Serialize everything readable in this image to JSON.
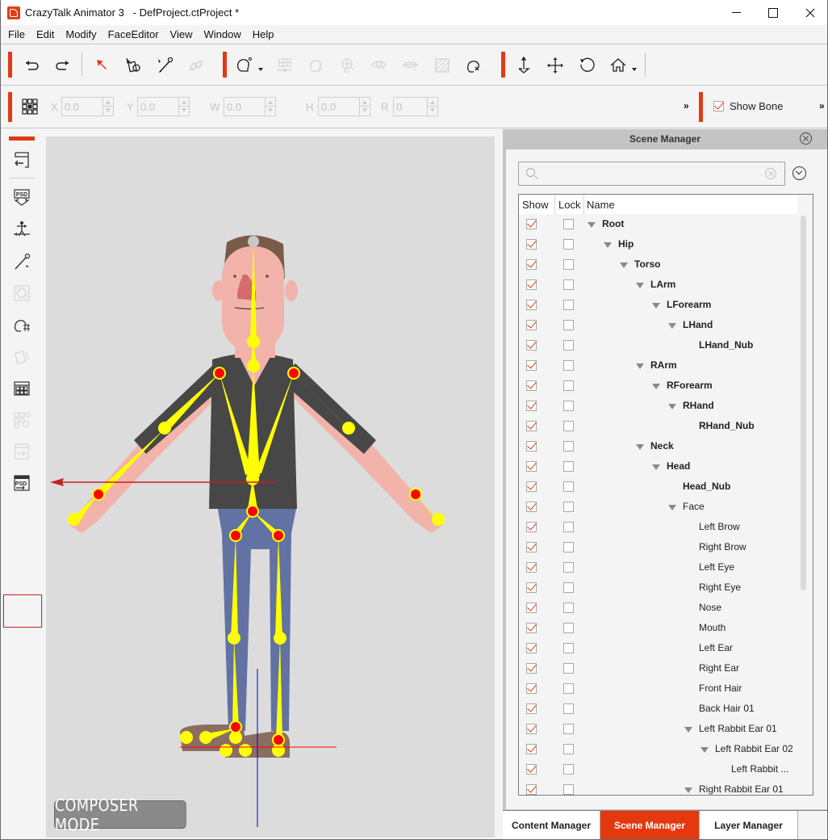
{
  "window": {
    "app_name": "CrazyTalk Animator 3",
    "title": "CrazyTalk Animator 3   - DefProject.ctProject *",
    "controls": [
      "minimize",
      "maximize",
      "close"
    ]
  },
  "menu": [
    "File",
    "Edit",
    "Modify",
    "FaceEditor",
    "View",
    "Window",
    "Help"
  ],
  "toolbar": {
    "groups": [
      {
        "icons": [
          "undo-icon",
          "redo-icon"
        ]
      },
      {
        "icons": [
          "select-icon",
          "transform-icon",
          "bone-edit-icon",
          "link-icon-disabled"
        ]
      },
      {
        "icons": [
          "face-setup-icon",
          "sprite-grid-icon-disabled",
          "head-turn-icon-disabled",
          "face-key-icon-disabled",
          "eye-icon-disabled",
          "mouth-icon-disabled",
          "mask-icon-disabled",
          "head-reset-icon"
        ]
      },
      {
        "icons": [
          "move-z-icon",
          "move-icon",
          "rotate-icon",
          "home-icon"
        ]
      }
    ]
  },
  "transform": {
    "anchor_icon": "anchor-grid-icon",
    "fields": [
      {
        "label": "X",
        "value": "0.0"
      },
      {
        "label": "Y",
        "value": "0.0"
      },
      {
        "label": "W",
        "value": "0.0"
      },
      {
        "label": "H",
        "value": "0.0"
      },
      {
        "label": "R",
        "value": "0"
      }
    ],
    "more_label": "»",
    "show_bone": {
      "label": "Show Bone",
      "checked": true
    }
  },
  "sidebar": {
    "items": [
      {
        "name": "back-to-stage-icon",
        "enabled": true
      },
      {
        "name": "psd-import-icon",
        "enabled": true
      },
      {
        "name": "bone-editor-icon",
        "enabled": true
      },
      {
        "name": "bone-brush-icon",
        "enabled": true
      },
      {
        "name": "mask-editor-icon",
        "enabled": false
      },
      {
        "name": "face-setup-icon",
        "enabled": true
      },
      {
        "name": "sprite-rotate-icon",
        "enabled": false
      },
      {
        "name": "sprite-grid-icon",
        "enabled": true
      },
      {
        "name": "sprite-settings-icon",
        "enabled": false
      },
      {
        "name": "export-icon",
        "enabled": false
      },
      {
        "name": "psd-export-icon",
        "enabled": true,
        "highlighted": true
      }
    ]
  },
  "viewport": {
    "mode_badge": "COMPOSER MODE"
  },
  "scene_manager": {
    "title": "Scene Manager",
    "search": {
      "value": "",
      "placeholder": ""
    },
    "columns": [
      "Show",
      "Lock",
      "Name"
    ],
    "rows": [
      {
        "name": "Root",
        "depth": 0,
        "expanded": true,
        "bold": true,
        "show": true,
        "lock": false
      },
      {
        "name": "Hip",
        "depth": 1,
        "expanded": true,
        "bold": true,
        "show": true,
        "lock": false
      },
      {
        "name": "Torso",
        "depth": 2,
        "expanded": true,
        "bold": true,
        "show": true,
        "lock": false
      },
      {
        "name": "LArm",
        "depth": 3,
        "expanded": true,
        "bold": true,
        "show": true,
        "lock": false
      },
      {
        "name": "LForearm",
        "depth": 4,
        "expanded": true,
        "bold": true,
        "show": true,
        "lock": false
      },
      {
        "name": "LHand",
        "depth": 5,
        "expanded": true,
        "bold": true,
        "show": true,
        "lock": false
      },
      {
        "name": "LHand_Nub",
        "depth": 6,
        "expanded": null,
        "bold": true,
        "show": true,
        "lock": false
      },
      {
        "name": "RArm",
        "depth": 3,
        "expanded": true,
        "bold": true,
        "show": true,
        "lock": false
      },
      {
        "name": "RForearm",
        "depth": 4,
        "expanded": true,
        "bold": true,
        "show": true,
        "lock": false
      },
      {
        "name": "RHand",
        "depth": 5,
        "expanded": true,
        "bold": true,
        "show": true,
        "lock": false
      },
      {
        "name": "RHand_Nub",
        "depth": 6,
        "expanded": null,
        "bold": true,
        "show": true,
        "lock": false
      },
      {
        "name": "Neck",
        "depth": 3,
        "expanded": true,
        "bold": true,
        "show": true,
        "lock": false
      },
      {
        "name": "Head",
        "depth": 4,
        "expanded": true,
        "bold": true,
        "show": true,
        "lock": false
      },
      {
        "name": "Head_Nub",
        "depth": 5,
        "expanded": null,
        "bold": true,
        "show": true,
        "lock": false
      },
      {
        "name": "Face",
        "depth": 5,
        "expanded": true,
        "bold": false,
        "show": true,
        "lock": false
      },
      {
        "name": "Left Brow",
        "depth": 6,
        "expanded": null,
        "bold": false,
        "show": true,
        "lock": false
      },
      {
        "name": "Right Brow",
        "depth": 6,
        "expanded": null,
        "bold": false,
        "show": true,
        "lock": false
      },
      {
        "name": "Left Eye",
        "depth": 6,
        "expanded": null,
        "bold": false,
        "show": true,
        "lock": false
      },
      {
        "name": "Right Eye",
        "depth": 6,
        "expanded": null,
        "bold": false,
        "show": true,
        "lock": false
      },
      {
        "name": "Nose",
        "depth": 6,
        "expanded": null,
        "bold": false,
        "show": true,
        "lock": false
      },
      {
        "name": "Mouth",
        "depth": 6,
        "expanded": null,
        "bold": false,
        "show": true,
        "lock": false
      },
      {
        "name": "Left Ear",
        "depth": 6,
        "expanded": null,
        "bold": false,
        "show": true,
        "lock": false
      },
      {
        "name": "Right Ear",
        "depth": 6,
        "expanded": null,
        "bold": false,
        "show": true,
        "lock": false
      },
      {
        "name": "Front Hair",
        "depth": 6,
        "expanded": null,
        "bold": false,
        "show": true,
        "lock": false
      },
      {
        "name": "Back Hair 01",
        "depth": 6,
        "expanded": null,
        "bold": false,
        "show": true,
        "lock": false
      },
      {
        "name": "Left Rabbit Ear 01",
        "depth": 6,
        "expanded": true,
        "bold": false,
        "show": true,
        "lock": false
      },
      {
        "name": "Left Rabbit Ear 02",
        "depth": 7,
        "expanded": true,
        "bold": false,
        "show": true,
        "lock": false
      },
      {
        "name": "Left Rabbit ...",
        "depth": 8,
        "expanded": null,
        "bold": false,
        "show": true,
        "lock": false
      },
      {
        "name": "Right Rabbit Ear 01",
        "depth": 6,
        "expanded": true,
        "bold": false,
        "show": true,
        "lock": false
      }
    ]
  },
  "bottom_tabs": [
    {
      "label": "Content Manager",
      "active": false
    },
    {
      "label": "Scene Manager",
      "active": true
    },
    {
      "label": "Layer Manager",
      "active": false
    }
  ],
  "colors": {
    "accent": "#e4380f",
    "bone": "#ffff00",
    "joint": "#ff0000",
    "axis_x": "#ff0000",
    "axis_y": "#0000cc"
  }
}
